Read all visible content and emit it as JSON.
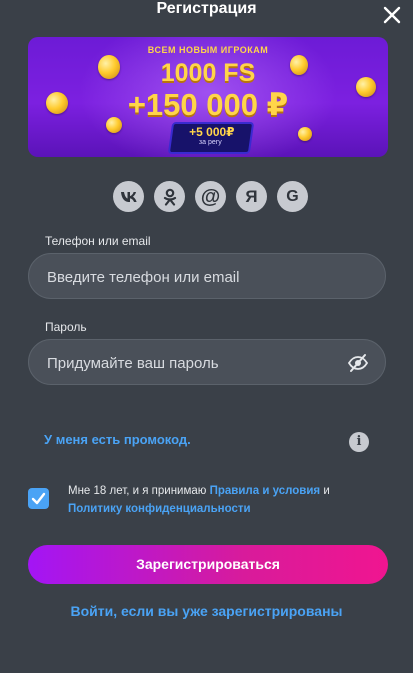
{
  "header": {
    "title": "Регистрация"
  },
  "banner": {
    "top_text": "ВСЕМ НОВЫМ ИГРОКАМ",
    "fs_text": "1000 FS",
    "rub_text": "+150 000 ₽",
    "badge_amount": "+5 000₽",
    "badge_sub": "за регу"
  },
  "socials": [
    {
      "name": "vk",
      "glyph": "vk"
    },
    {
      "name": "ok",
      "glyph": "ok"
    },
    {
      "name": "mail",
      "glyph": "@"
    },
    {
      "name": "yandex",
      "glyph": "Я"
    },
    {
      "name": "google",
      "glyph": "G"
    }
  ],
  "form": {
    "phone_label": "Телефон или email",
    "phone_placeholder": "Введите телефон или email",
    "password_label": "Пароль",
    "password_placeholder": "Придумайте ваш пароль",
    "promo_text": "У меня есть промокод.",
    "terms_prefix": "Мне 18 лет, и я принимаю ",
    "terms_link": "Правила и условия",
    "terms_and": " и ",
    "privacy_link": "Политику конфиденциальности",
    "agree_checked": true,
    "submit_label": "Зарегистрироваться",
    "login_link": "Войти, если вы уже зарегистрированы"
  },
  "colors": {
    "background": "#3a4048",
    "accent_link": "#4aa3f5",
    "button_start": "#a315f5",
    "button_end": "#f01590"
  }
}
